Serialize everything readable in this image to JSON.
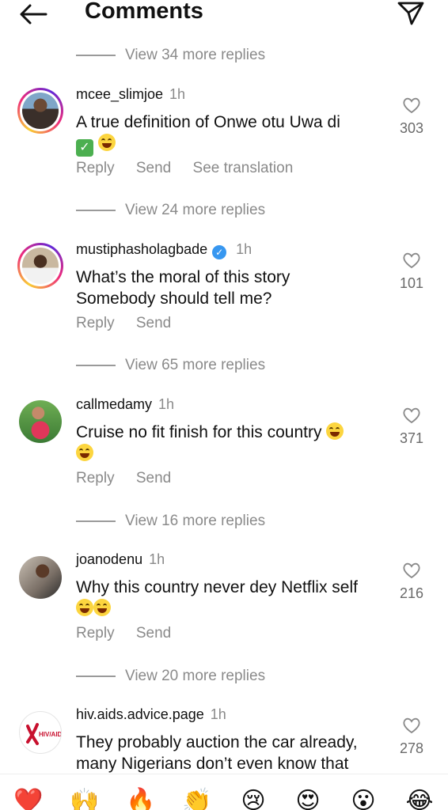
{
  "header": {
    "title": "Comments"
  },
  "threads": [
    {
      "view_more": "View 34 more replies"
    },
    {
      "view_more": "View 24 more replies"
    },
    {
      "view_more": "View 65 more replies"
    },
    {
      "view_more": "View 16 more replies"
    },
    {
      "view_more": "View 20 more replies"
    }
  ],
  "comments": [
    {
      "username": "mcee_slimjoe",
      "time": "1h",
      "text": "A true definition of Onwe otu Uwa di",
      "likes": "303",
      "reply": "Reply",
      "send": "Send",
      "translate": "See translation"
    },
    {
      "username": "mustiphasholagbade",
      "time": "1h",
      "text_line1": "What’s the moral of this story",
      "text_line2": "Somebody should tell me?",
      "likes": "101",
      "reply": "Reply",
      "send": "Send"
    },
    {
      "username": "callmedamy",
      "time": "1h",
      "text": "Cruise no fit finish for this country",
      "likes": "371",
      "reply": "Reply",
      "send": "Send"
    },
    {
      "username": "joanodenu",
      "time": "1h",
      "text": "Why this country never dey Netflix self",
      "likes": "216",
      "reply": "Reply",
      "send": "Send"
    },
    {
      "username": "hiv.aids.advice.page",
      "time": "1h",
      "text_line1": "They probably auction the car already,",
      "text_line2": "many Nigerians don’t even know that",
      "likes": "278",
      "avatar_label": "HIV/AIDS"
    }
  ],
  "reactions": [
    "❤️",
    "🙌",
    "🔥",
    "👏",
    "😢",
    "😍",
    "😮",
    "😂"
  ]
}
